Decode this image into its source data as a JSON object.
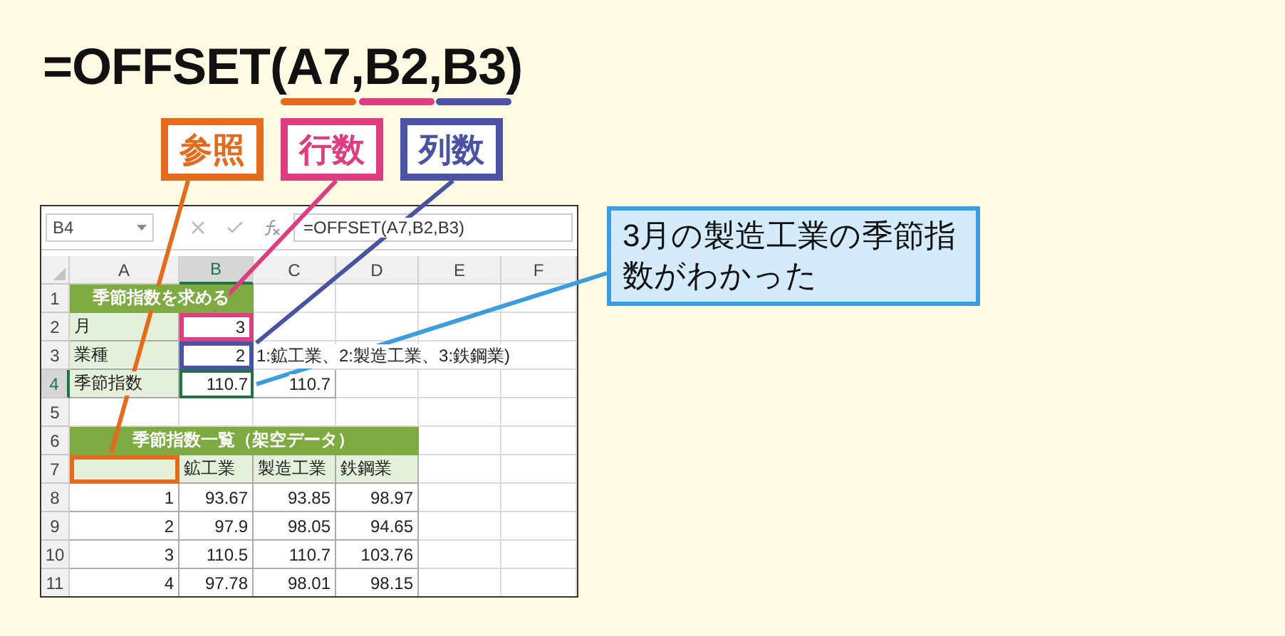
{
  "formula": {
    "prefix": "=OFFSET(",
    "args": [
      {
        "text": "A7",
        "color": "#e56a1c"
      },
      {
        "text": "B2",
        "color": "#e03d80"
      },
      {
        "text": "B3",
        "color": "#4a53a3"
      }
    ],
    "separator": ",",
    "suffix": ")"
  },
  "labels": [
    {
      "text": "参照",
      "color": "#e56a1c"
    },
    {
      "text": "行数",
      "color": "#e03d80"
    },
    {
      "text": "列数",
      "color": "#4a53a3"
    }
  ],
  "sheet": {
    "name_box": "B4",
    "formula": "=OFFSET(A7,B2,B3)",
    "columns": [
      "A",
      "B",
      "C",
      "D",
      "E",
      "F"
    ],
    "rows": [
      {
        "number": "1",
        "cells": [
          {
            "text": "季節指数を求める",
            "kind": "title",
            "selected": false
          }
        ]
      },
      {
        "number": "2",
        "cells": [
          {
            "text": "月",
            "kind": "label",
            "selected": false
          },
          {
            "text": "3",
            "kind": "number",
            "selected": false,
            "color": "#e03d80"
          }
        ]
      },
      {
        "number": "3",
        "cells": [
          {
            "text": "業種",
            "kind": "label",
            "selected": false
          },
          {
            "text": "2",
            "kind": "number",
            "selected": false,
            "color": "#4a53a3"
          },
          {
            "text": "1:鉱工業、2:製造工業、3:鉄鋼業)",
            "kind": "note",
            "selected": false
          }
        ]
      },
      {
        "number": "4",
        "cells": [
          {
            "text": "季節指数",
            "kind": "label",
            "selected": false
          },
          {
            "text": "110.7",
            "kind": "number",
            "selected": true
          },
          {
            "text": "110.7",
            "kind": "number",
            "selected": false
          }
        ]
      },
      {
        "number": "5",
        "cells": []
      },
      {
        "number": "6",
        "cells": [
          {
            "text": "季節指数一覧（架空データ）",
            "kind": "title",
            "selected": false
          }
        ]
      },
      {
        "number": "7",
        "cells": [
          {
            "kind": "label",
            "selected": false,
            "color": "#e56a1c"
          },
          {
            "text": "鉱工業",
            "kind": "label",
            "selected": false
          },
          {
            "text": "製造工業",
            "kind": "label",
            "selected": false
          },
          {
            "text": "鉄鋼業",
            "kind": "label",
            "selected": false
          }
        ]
      },
      {
        "number": "8",
        "cells": [
          {
            "text": "1",
            "kind": "number",
            "selected": false
          },
          {
            "text": "93.67",
            "kind": "number",
            "selected": false
          },
          {
            "text": "93.85",
            "kind": "number",
            "selected": false
          },
          {
            "text": "98.97",
            "kind": "number",
            "selected": false
          }
        ]
      },
      {
        "number": "9",
        "cells": [
          {
            "text": "2",
            "kind": "number",
            "selected": false
          },
          {
            "text": "97.9",
            "kind": "number",
            "selected": false
          },
          {
            "text": "98.05",
            "kind": "number",
            "selected": false
          },
          {
            "text": "94.65",
            "kind": "number",
            "selected": false
          }
        ]
      },
      {
        "number": "10",
        "cells": [
          {
            "text": "3",
            "kind": "number",
            "selected": false
          },
          {
            "text": "110.5",
            "kind": "number",
            "selected": false
          },
          {
            "text": "110.7",
            "kind": "number",
            "selected": false
          },
          {
            "text": "103.76",
            "kind": "number",
            "selected": false
          }
        ]
      },
      {
        "number": "11",
        "cells": [
          {
            "text": "4",
            "kind": "number",
            "selected": false
          },
          {
            "text": "97.78",
            "kind": "number",
            "selected": false
          },
          {
            "text": "98.01",
            "kind": "number",
            "selected": false
          },
          {
            "text": "98.15",
            "kind": "number",
            "selected": false
          }
        ]
      }
    ]
  },
  "callout": {
    "text": "3月の製造工業の季節指数がわかった"
  }
}
